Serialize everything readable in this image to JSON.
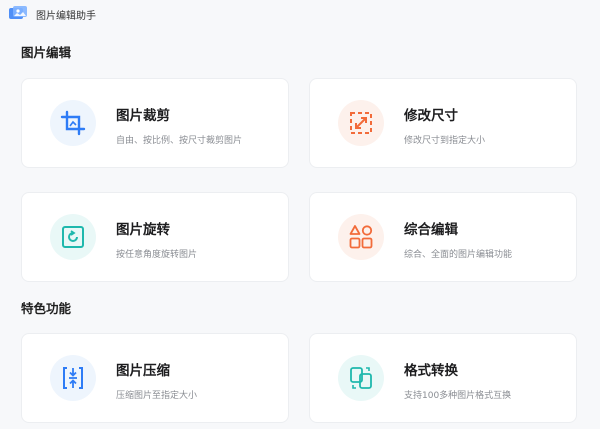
{
  "app": {
    "title": "图片编辑助手"
  },
  "sections": [
    {
      "title": "图片编辑"
    },
    {
      "title": "特色功能"
    }
  ],
  "cards": {
    "crop": {
      "title": "图片裁剪",
      "desc": "自由、按比例、按尺寸裁剪图片",
      "icon": "crop-icon",
      "color": "#2e7cf6"
    },
    "resize": {
      "title": "修改尺寸",
      "desc": "修改尺寸到指定大小",
      "icon": "resize-icon",
      "color": "#f26b3a"
    },
    "rotate": {
      "title": "图片旋转",
      "desc": "按任意角度旋转图片",
      "icon": "rotate-icon",
      "color": "#1fb8ad"
    },
    "edit": {
      "title": "综合编辑",
      "desc": "综合、全面的图片编辑功能",
      "icon": "shapes-icon",
      "color": "#f26b3a"
    },
    "compress": {
      "title": "图片压缩",
      "desc": "压缩图片至指定大小",
      "icon": "compress-icon",
      "color": "#2e7cf6"
    },
    "convert": {
      "title": "格式转换",
      "desc": "支持100多种图片格式互换",
      "icon": "convert-icon",
      "color": "#1fb8ad"
    }
  }
}
